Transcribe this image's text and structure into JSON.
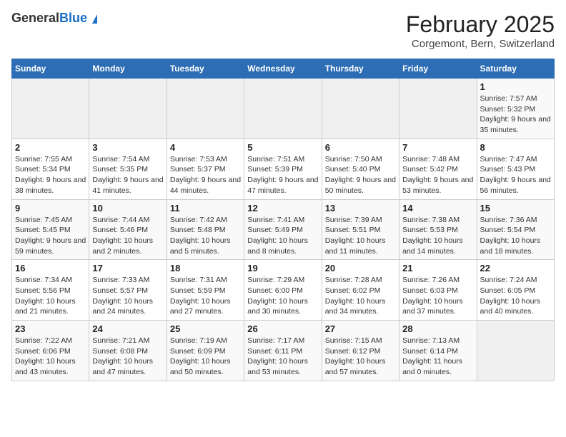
{
  "header": {
    "logo_general": "General",
    "logo_blue": "Blue",
    "title": "February 2025",
    "subtitle": "Corgemont, Bern, Switzerland"
  },
  "calendar": {
    "weekdays": [
      "Sunday",
      "Monday",
      "Tuesday",
      "Wednesday",
      "Thursday",
      "Friday",
      "Saturday"
    ],
    "weeks": [
      [
        {
          "day": "",
          "info": ""
        },
        {
          "day": "",
          "info": ""
        },
        {
          "day": "",
          "info": ""
        },
        {
          "day": "",
          "info": ""
        },
        {
          "day": "",
          "info": ""
        },
        {
          "day": "",
          "info": ""
        },
        {
          "day": "1",
          "info": "Sunrise: 7:57 AM\nSunset: 5:32 PM\nDaylight: 9 hours and 35 minutes."
        }
      ],
      [
        {
          "day": "2",
          "info": "Sunrise: 7:55 AM\nSunset: 5:34 PM\nDaylight: 9 hours and 38 minutes."
        },
        {
          "day": "3",
          "info": "Sunrise: 7:54 AM\nSunset: 5:35 PM\nDaylight: 9 hours and 41 minutes."
        },
        {
          "day": "4",
          "info": "Sunrise: 7:53 AM\nSunset: 5:37 PM\nDaylight: 9 hours and 44 minutes."
        },
        {
          "day": "5",
          "info": "Sunrise: 7:51 AM\nSunset: 5:39 PM\nDaylight: 9 hours and 47 minutes."
        },
        {
          "day": "6",
          "info": "Sunrise: 7:50 AM\nSunset: 5:40 PM\nDaylight: 9 hours and 50 minutes."
        },
        {
          "day": "7",
          "info": "Sunrise: 7:48 AM\nSunset: 5:42 PM\nDaylight: 9 hours and 53 minutes."
        },
        {
          "day": "8",
          "info": "Sunrise: 7:47 AM\nSunset: 5:43 PM\nDaylight: 9 hours and 56 minutes."
        }
      ],
      [
        {
          "day": "9",
          "info": "Sunrise: 7:45 AM\nSunset: 5:45 PM\nDaylight: 9 hours and 59 minutes."
        },
        {
          "day": "10",
          "info": "Sunrise: 7:44 AM\nSunset: 5:46 PM\nDaylight: 10 hours and 2 minutes."
        },
        {
          "day": "11",
          "info": "Sunrise: 7:42 AM\nSunset: 5:48 PM\nDaylight: 10 hours and 5 minutes."
        },
        {
          "day": "12",
          "info": "Sunrise: 7:41 AM\nSunset: 5:49 PM\nDaylight: 10 hours and 8 minutes."
        },
        {
          "day": "13",
          "info": "Sunrise: 7:39 AM\nSunset: 5:51 PM\nDaylight: 10 hours and 11 minutes."
        },
        {
          "day": "14",
          "info": "Sunrise: 7:38 AM\nSunset: 5:53 PM\nDaylight: 10 hours and 14 minutes."
        },
        {
          "day": "15",
          "info": "Sunrise: 7:36 AM\nSunset: 5:54 PM\nDaylight: 10 hours and 18 minutes."
        }
      ],
      [
        {
          "day": "16",
          "info": "Sunrise: 7:34 AM\nSunset: 5:56 PM\nDaylight: 10 hours and 21 minutes."
        },
        {
          "day": "17",
          "info": "Sunrise: 7:33 AM\nSunset: 5:57 PM\nDaylight: 10 hours and 24 minutes."
        },
        {
          "day": "18",
          "info": "Sunrise: 7:31 AM\nSunset: 5:59 PM\nDaylight: 10 hours and 27 minutes."
        },
        {
          "day": "19",
          "info": "Sunrise: 7:29 AM\nSunset: 6:00 PM\nDaylight: 10 hours and 30 minutes."
        },
        {
          "day": "20",
          "info": "Sunrise: 7:28 AM\nSunset: 6:02 PM\nDaylight: 10 hours and 34 minutes."
        },
        {
          "day": "21",
          "info": "Sunrise: 7:26 AM\nSunset: 6:03 PM\nDaylight: 10 hours and 37 minutes."
        },
        {
          "day": "22",
          "info": "Sunrise: 7:24 AM\nSunset: 6:05 PM\nDaylight: 10 hours and 40 minutes."
        }
      ],
      [
        {
          "day": "23",
          "info": "Sunrise: 7:22 AM\nSunset: 6:06 PM\nDaylight: 10 hours and 43 minutes."
        },
        {
          "day": "24",
          "info": "Sunrise: 7:21 AM\nSunset: 6:08 PM\nDaylight: 10 hours and 47 minutes."
        },
        {
          "day": "25",
          "info": "Sunrise: 7:19 AM\nSunset: 6:09 PM\nDaylight: 10 hours and 50 minutes."
        },
        {
          "day": "26",
          "info": "Sunrise: 7:17 AM\nSunset: 6:11 PM\nDaylight: 10 hours and 53 minutes."
        },
        {
          "day": "27",
          "info": "Sunrise: 7:15 AM\nSunset: 6:12 PM\nDaylight: 10 hours and 57 minutes."
        },
        {
          "day": "28",
          "info": "Sunrise: 7:13 AM\nSunset: 6:14 PM\nDaylight: 11 hours and 0 minutes."
        },
        {
          "day": "",
          "info": ""
        }
      ]
    ]
  }
}
